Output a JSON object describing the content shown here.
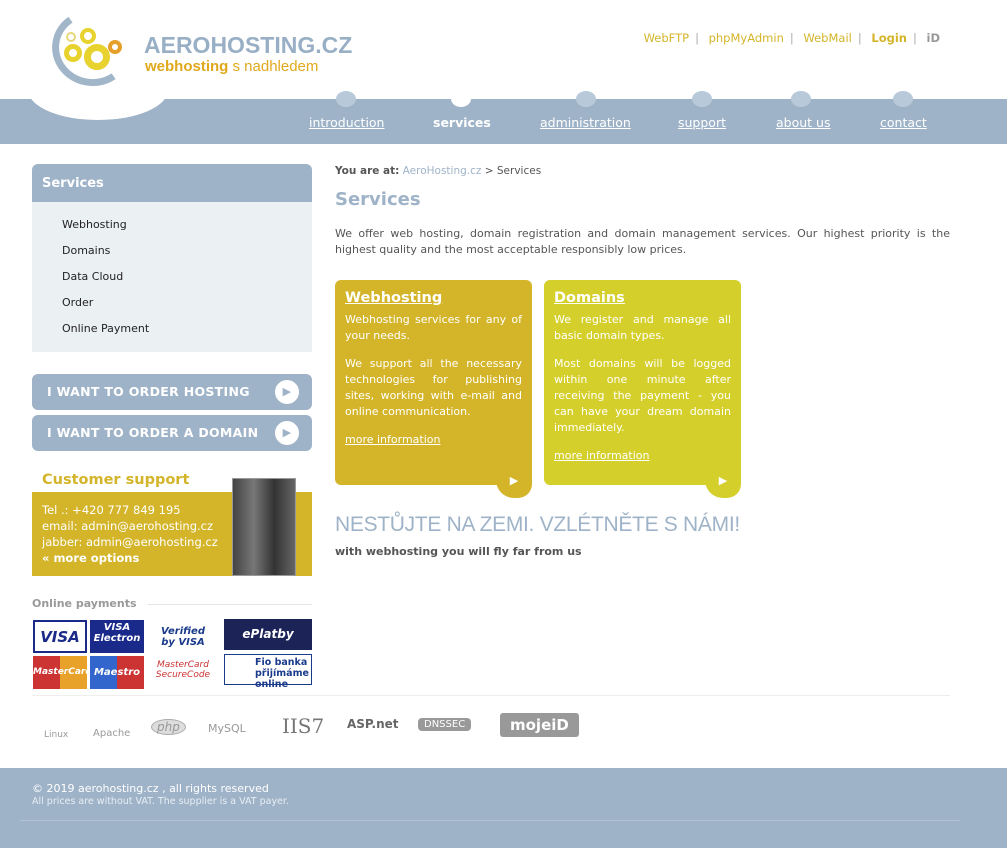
{
  "header": {
    "brand": "AEROHOSTING.CZ",
    "tagline_bold": "webhosting",
    "tagline_rest": " s nadhledem",
    "top_links": [
      "WebFTP",
      "phpMyAdmin",
      "WebMail",
      "Login"
    ],
    "mojeid_icon": "iD"
  },
  "nav": [
    "introduction",
    "services",
    "administration",
    "support",
    "about us",
    "contact"
  ],
  "sidebar": {
    "title": "Services",
    "items": [
      "Webhosting",
      "Domains",
      "Data Cloud",
      "Order",
      "Online Payment"
    ],
    "order_hosting": "I WANT TO ORDER HOSTING",
    "order_domain": "I WANT TO ORDER A DOMAIN"
  },
  "support": {
    "title": "Customer support",
    "tel": "Tel .: +420 777 849 195",
    "email_label": "email: ",
    "email": "admin@aerohosting.cz",
    "jabber_label": "jabber: ",
    "jabber": "admin@aerohosting.cz",
    "more": "more options",
    "more_prefix": "«"
  },
  "payments": {
    "title": "Online payments",
    "cards": [
      "VISA",
      "VISA Electron",
      "Verified by VISA",
      "ePlatby",
      "MasterCard",
      "Maestro",
      "MasterCard SecureCode",
      "Fio banka přijímáme online"
    ]
  },
  "main": {
    "crumb_label": "You are at:",
    "crumb_home": "AeroHosting.cz",
    "crumb_current": " > Services",
    "title": "Services",
    "intro": "We offer web hosting, domain registration and domain management services. Our highest priority is the highest quality and the most acceptable responsibly low prices.",
    "boxes": [
      {
        "title": "Webhosting",
        "p1": "Webhosting services for any of your needs.",
        "p2": "We support all the necessary technologies for publishing sites, working with e-mail and online communication.",
        "more": "more information",
        "color": "#d4b52a"
      },
      {
        "title": "Domains",
        "p1": "We register and manage all basic domain types.",
        "p2": "Most domains will be logged within one minute after receiving the payment - you can have your dream domain immediately.",
        "more": "more information",
        "color": "#d5cf2c"
      }
    ],
    "slogan": "NESTŮJTE NA ZEMI. VZLÉTNĚTE S NÁMI!",
    "sub": "with webhosting you will fly far from us"
  },
  "tech": [
    "Linux",
    "Apache",
    "php",
    "MySQL",
    "IIS7",
    "ASP.net",
    "DNSSEC",
    "mojeiD"
  ],
  "footer": {
    "copy": "© 2019 aerohosting.cz , all rights reserved",
    "vat": "All prices are without VAT. The supplier is a VAT payer."
  },
  "colors": {
    "accent": "#9fb3c8",
    "gold": "#d4b52a",
    "lime": "#d5cf2c"
  }
}
